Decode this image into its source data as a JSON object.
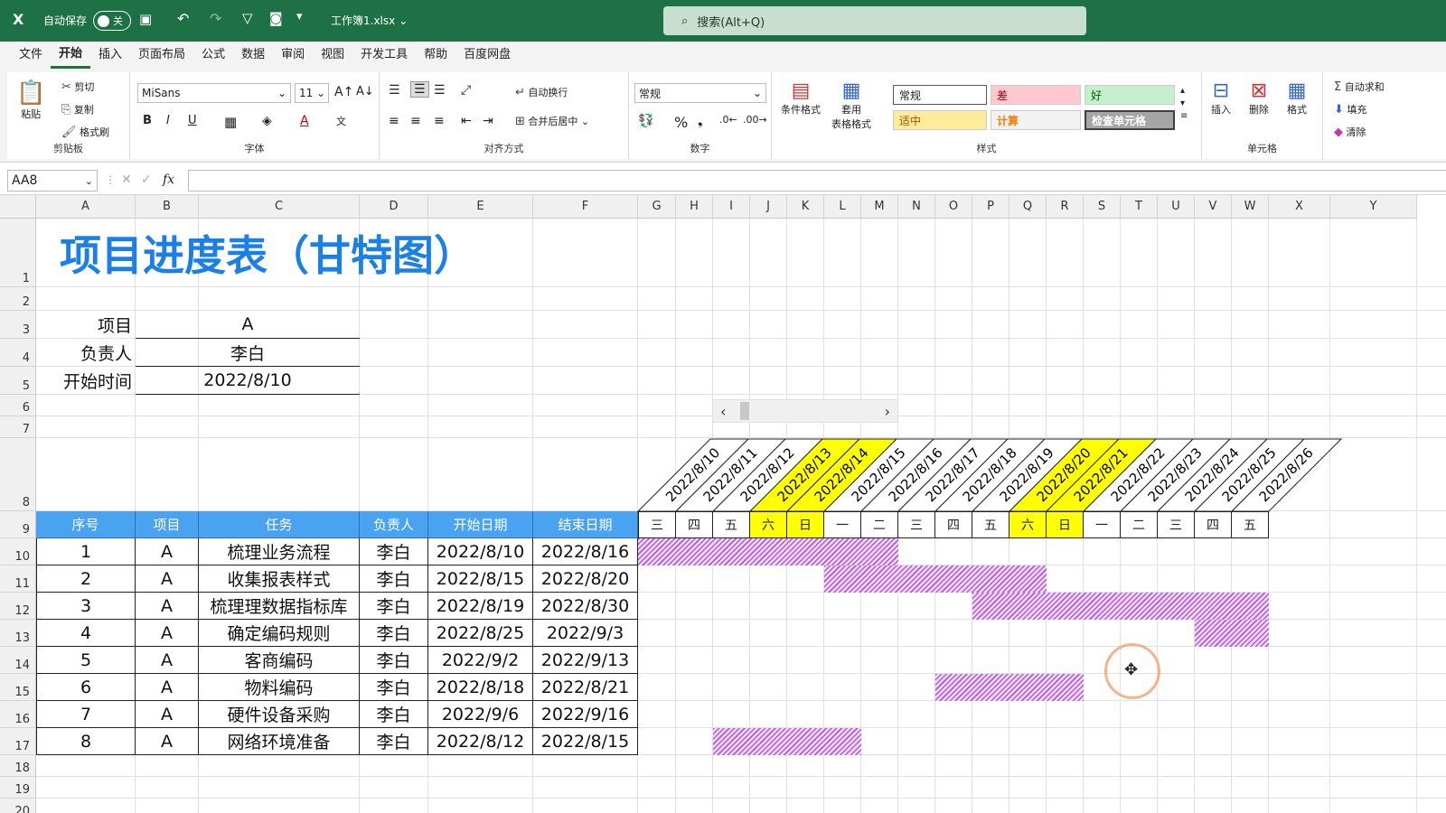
{
  "titlebar": {
    "autosave_label": "自动保存",
    "autosave_state": "关",
    "filename": "工作簿1.xlsx",
    "search_placeholder": "搜索(Alt+Q)"
  },
  "menu": [
    "文件",
    "开始",
    "插入",
    "页面布局",
    "公式",
    "数据",
    "审阅",
    "视图",
    "开发工具",
    "帮助",
    "百度网盘"
  ],
  "menu_active": "开始",
  "ribbon": {
    "clipboard": {
      "paste": "粘贴",
      "cut": "剪切",
      "copy": "复制",
      "format_painter": "格式刷",
      "label": "剪贴板"
    },
    "font": {
      "name": "MiSans",
      "size": "11",
      "bold": "B",
      "italic": "I",
      "underline": "U",
      "label": "字体"
    },
    "align": {
      "wrap": "自动换行",
      "merge": "合并后居中",
      "label": "对齐方式"
    },
    "number": {
      "format": "常规",
      "label": "数字"
    },
    "styles": {
      "cond": "条件格式",
      "table": "套用\n表格格式",
      "normal": "常规",
      "bad": "差",
      "good": "好",
      "neutral": "适中",
      "calc": "计算",
      "check": "检查单元格",
      "label": "样式"
    },
    "cells": {
      "insert": "插入",
      "delete": "删除",
      "format": "格式",
      "label": "单元格"
    },
    "editing": {
      "autosum": "自动求和",
      "fill": "填充",
      "clear": "清除"
    }
  },
  "formula_bar": {
    "name_box": "AA8",
    "fx": "fx",
    "content": ""
  },
  "columns": [
    "A",
    "B",
    "C",
    "D",
    "E",
    "F",
    "G",
    "H",
    "I",
    "J",
    "K",
    "L",
    "M",
    "N",
    "O",
    "P",
    "Q",
    "R",
    "S",
    "T",
    "U",
    "V",
    "W",
    "X",
    "Y"
  ],
  "rows": [
    "1",
    "2",
    "3",
    "4",
    "5",
    "6",
    "7",
    "8",
    "9",
    "10",
    "11",
    "12",
    "13",
    "14",
    "15",
    "16",
    "17",
    "18",
    "19",
    "20"
  ],
  "sheet": {
    "title": "项目进度表（甘特图）",
    "info": [
      {
        "label": "项目",
        "value": "A"
      },
      {
        "label": "负责人",
        "value": "李白"
      },
      {
        "label": "开始时间",
        "value": "2022/8/10"
      }
    ],
    "headers": [
      "序号",
      "项目",
      "任务",
      "负责人",
      "开始日期",
      "结束日期"
    ],
    "tasks": [
      {
        "no": "1",
        "proj": "A",
        "task": "梳理业务流程",
        "owner": "李白",
        "start": "2022/8/10",
        "end": "2022/8/16"
      },
      {
        "no": "2",
        "proj": "A",
        "task": "收集报表样式",
        "owner": "李白",
        "start": "2022/8/15",
        "end": "2022/8/20"
      },
      {
        "no": "3",
        "proj": "A",
        "task": "梳理理数据指标库",
        "owner": "李白",
        "start": "2022/8/19",
        "end": "2022/8/30"
      },
      {
        "no": "4",
        "proj": "A",
        "task": "确定编码规则",
        "owner": "李白",
        "start": "2022/8/25",
        "end": "2022/9/3"
      },
      {
        "no": "5",
        "proj": "A",
        "task": "客商编码",
        "owner": "李白",
        "start": "2022/9/2",
        "end": "2022/9/13"
      },
      {
        "no": "6",
        "proj": "A",
        "task": "物料编码",
        "owner": "李白",
        "start": "2022/8/18",
        "end": "2022/8/21"
      },
      {
        "no": "7",
        "proj": "A",
        "task": "硬件设备采购",
        "owner": "李白",
        "start": "2022/9/6",
        "end": "2022/9/16"
      },
      {
        "no": "8",
        "proj": "A",
        "task": "网络环境准备",
        "owner": "李白",
        "start": "2022/8/12",
        "end": "2022/8/15"
      }
    ],
    "dates": [
      "2022/8/10",
      "2022/8/11",
      "2022/8/12",
      "2022/8/13",
      "2022/8/14",
      "2022/8/15",
      "2022/8/16",
      "2022/8/17",
      "2022/8/18",
      "2022/8/19",
      "2022/8/20",
      "2022/8/21",
      "2022/8/22",
      "2022/8/23",
      "2022/8/24",
      "2022/8/25",
      "2022/8/26"
    ],
    "weekdays": [
      "三",
      "四",
      "五",
      "六",
      "日",
      "一",
      "二",
      "三",
      "四",
      "五",
      "六",
      "日",
      "一",
      "二",
      "三",
      "四",
      "五"
    ],
    "weekend_idx": [
      3,
      4,
      10,
      11
    ],
    "bars": [
      {
        "row": 0,
        "start": 0,
        "end": 6
      },
      {
        "row": 1,
        "start": 5,
        "end": 10
      },
      {
        "row": 2,
        "start": 9,
        "end": 16
      },
      {
        "row": 3,
        "start": 15,
        "end": 16
      },
      {
        "row": 5,
        "start": 8,
        "end": 11
      },
      {
        "row": 7,
        "start": 2,
        "end": 5
      }
    ]
  },
  "colors": {
    "green": "#1e7145",
    "header_blue": "#4aa3f0",
    "weekend_yellow": "#ffff00",
    "bar_purple": "#b05ad8",
    "title_blue": "#1a7fe6"
  }
}
